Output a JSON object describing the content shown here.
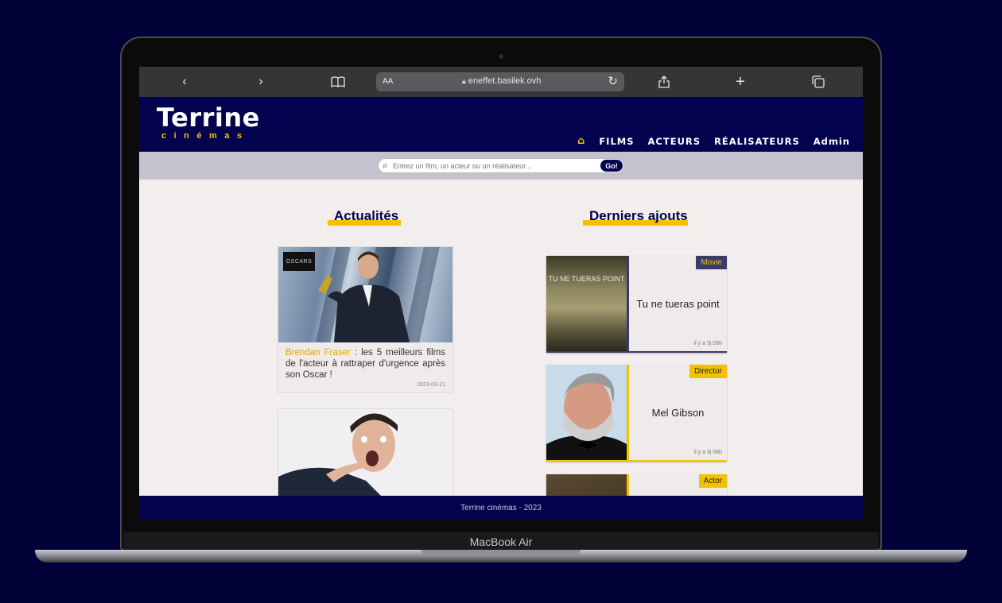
{
  "browser": {
    "text_size_label": "AA",
    "address": "eneffet.basilek.ovh",
    "icons": [
      "back-icon",
      "forward-icon",
      "bookmarks-icon",
      "lock-icon",
      "reload-icon",
      "share-icon",
      "new-tab-icon",
      "tabs-icon"
    ]
  },
  "site": {
    "logo_main": "Terrine",
    "logo_sub": "cinémas",
    "nav": {
      "films": "FILMS",
      "actors": "ACTEURS",
      "directors": "RÉALISATEURS",
      "admin": "Admin"
    },
    "search": {
      "placeholder": "Entrez un film, un acteur ou un réalisateur...",
      "button": "Go!"
    }
  },
  "news": {
    "title": "Actualités",
    "items": [
      {
        "badge": "OSCARS",
        "highlight": "Brendan Fraser",
        "text": " : les 5 meilleurs films de l'acteur à rattraper d'urgence après son Oscar !",
        "date": "2023-03-21"
      }
    ]
  },
  "latest": {
    "title": "Derniers ajouts",
    "items": [
      {
        "type": "Movie",
        "name": "Tu ne tueras point",
        "time": "il y a 3j 06h",
        "poster_text": "TU NE TUERAS POINT",
        "accent": "#3b3b6b"
      },
      {
        "type": "Director",
        "name": "Mel Gibson",
        "time": "il y a 3j 06h",
        "accent": "#f2c200"
      },
      {
        "type": "Actor",
        "accent": "#f2c200"
      }
    ]
  },
  "footer": {
    "text": "Terrine cinémas - 2023"
  },
  "device": {
    "label": "MacBook Air"
  },
  "colors": {
    "navy": "#02024f",
    "gold": "#f2c200",
    "page_bg": "#f3eeee"
  }
}
